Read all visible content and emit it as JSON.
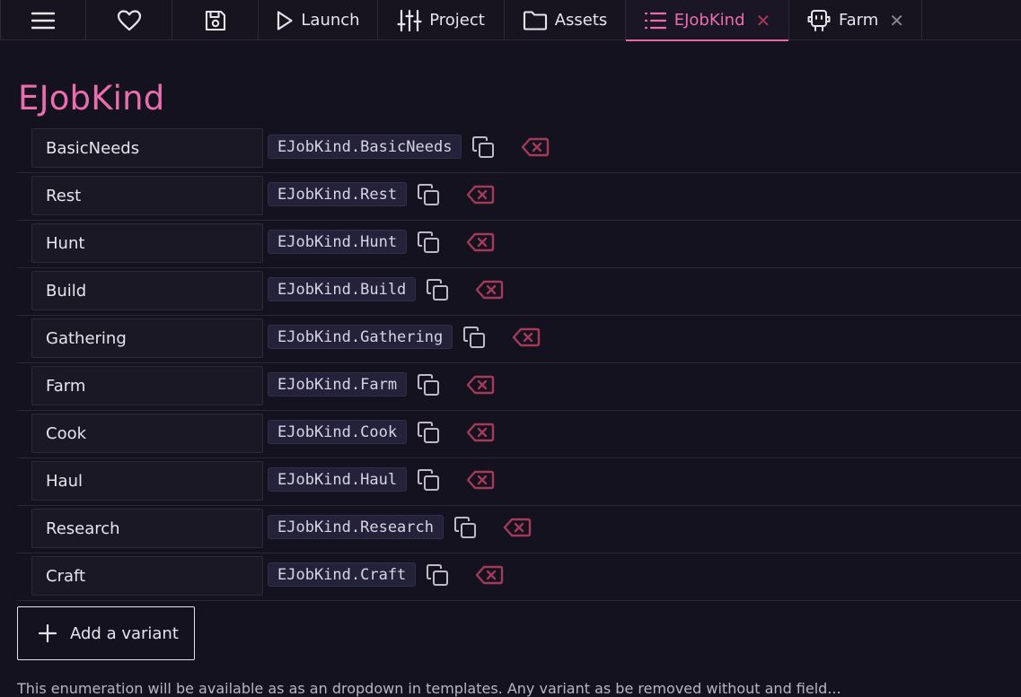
{
  "topbar": {
    "buttons": [
      {
        "name": "menu",
        "label": ""
      },
      {
        "name": "favorites",
        "label": ""
      },
      {
        "name": "save",
        "label": ""
      }
    ],
    "tabs": [
      {
        "label": "Launch",
        "icon": "play-icon",
        "closable": false,
        "active": false
      },
      {
        "label": "Project",
        "icon": "sliders-icon",
        "closable": false,
        "active": false
      },
      {
        "label": "Assets",
        "icon": "folder-icon",
        "closable": false,
        "active": false
      },
      {
        "label": "EJobKind",
        "icon": "list-icon",
        "closable": true,
        "active": true
      },
      {
        "label": "Farm",
        "icon": "robot-icon",
        "closable": true,
        "active": false
      }
    ],
    "close_glyph": "✕"
  },
  "page": {
    "title": "EJobKind",
    "variants": [
      {
        "name": "BasicNeeds",
        "code": "EJobKind.BasicNeeds"
      },
      {
        "name": "Rest",
        "code": "EJobKind.Rest"
      },
      {
        "name": "Hunt",
        "code": "EJobKind.Hunt"
      },
      {
        "name": "Build",
        "code": "EJobKind.Build"
      },
      {
        "name": "Gathering",
        "code": "EJobKind.Gathering"
      },
      {
        "name": "Farm",
        "code": "EJobKind.Farm"
      },
      {
        "name": "Cook",
        "code": "EJobKind.Cook"
      },
      {
        "name": "Haul",
        "code": "EJobKind.Haul"
      },
      {
        "name": "Research",
        "code": "EJobKind.Research"
      },
      {
        "name": "Craft",
        "code": "EJobKind.Craft"
      }
    ],
    "add_label": "Add a variant",
    "footnote": "This enumeration will be available as as an dropdown in templates. Any variant as be removed without and field..."
  },
  "colors": {
    "accent": "#ea6eaf",
    "delete": "#a33a58",
    "background": "#15121f"
  }
}
